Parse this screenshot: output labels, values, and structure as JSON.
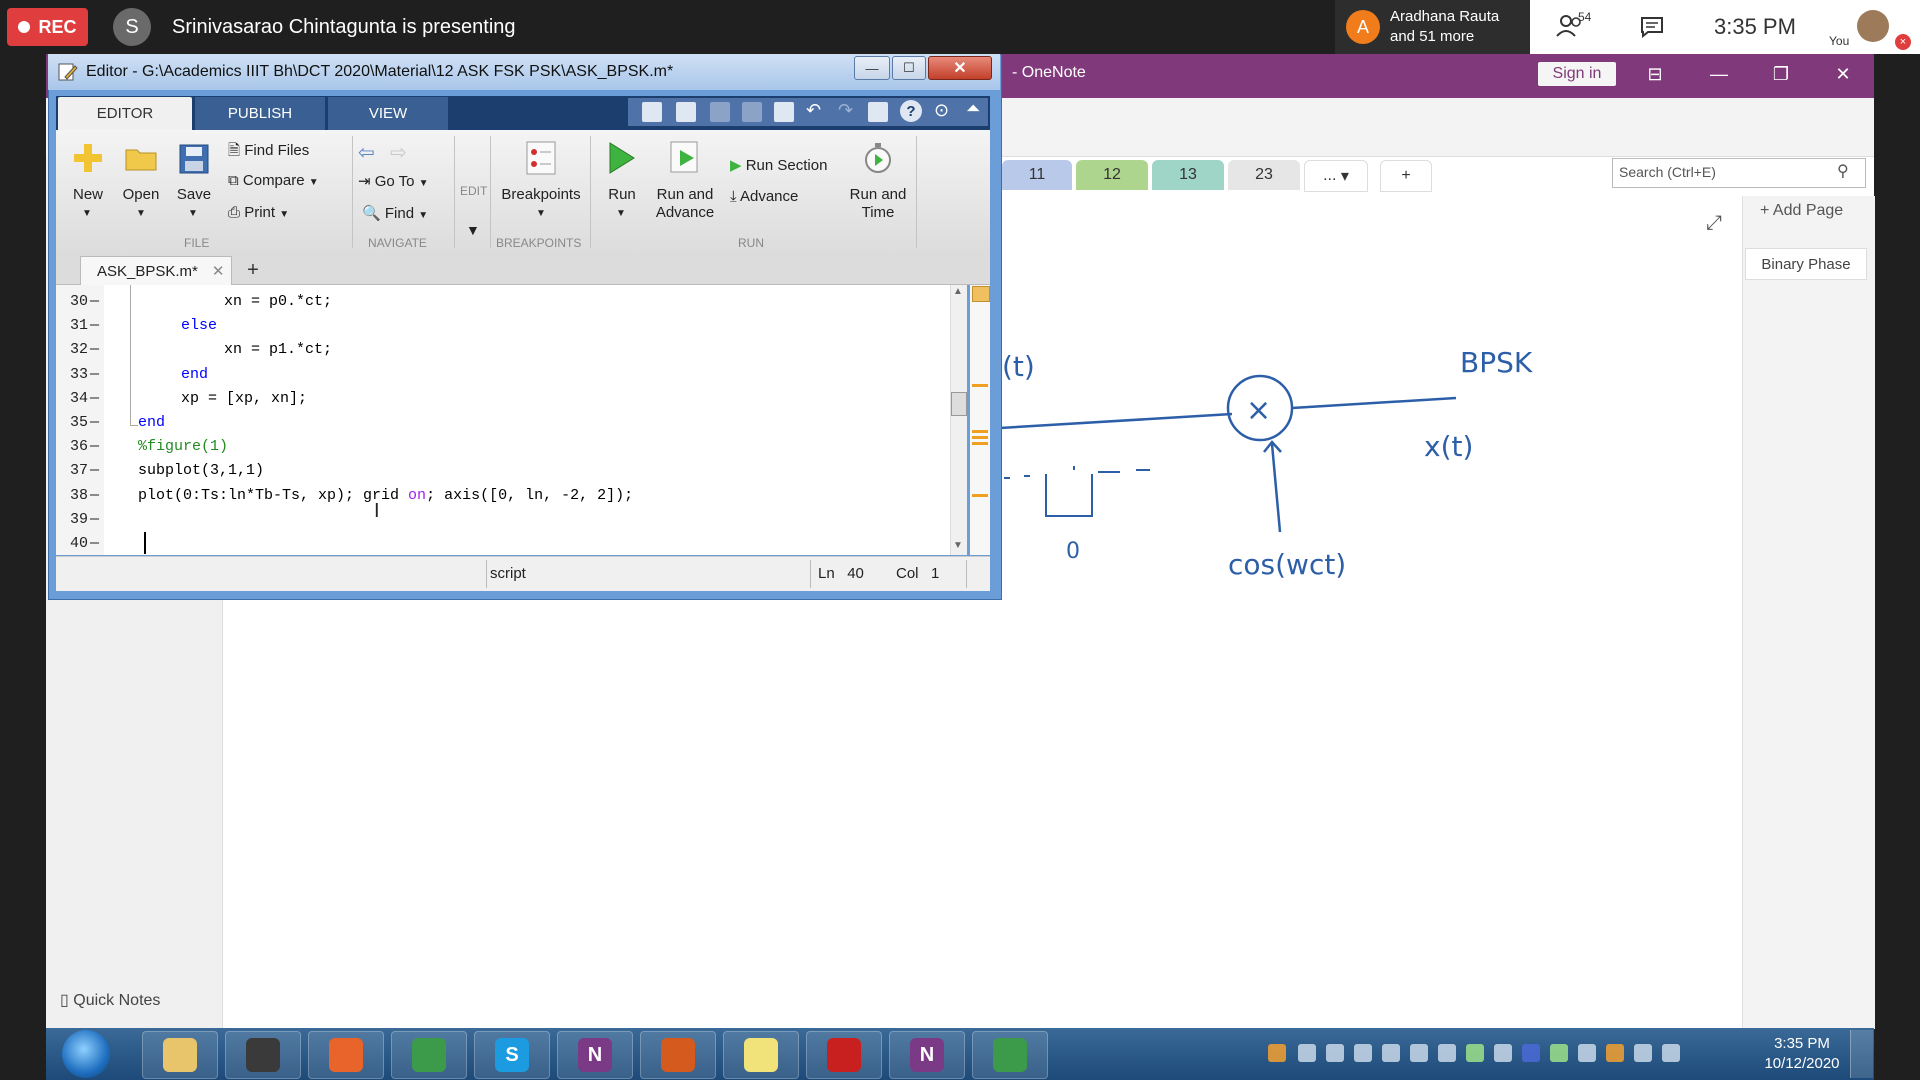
{
  "meeting": {
    "rec_label": "REC",
    "presenter_initial": "S",
    "presenting_text": "Srinivasarao Chintagunta is presenting",
    "viewer_initial": "A",
    "viewer_line1": "Aradhana Rauta",
    "viewer_line2": "and 51 more",
    "participant_count": "54",
    "time": "3:35 PM",
    "you_label": "You"
  },
  "onenote": {
    "title": "- OneNote",
    "sign_in": "Sign in",
    "section_tabs": [
      {
        "label": "11",
        "color": "#b9c9ea"
      },
      {
        "label": "12",
        "color": "#aed58e"
      },
      {
        "label": "13",
        "color": "#9fd5c6"
      },
      {
        "label": "23",
        "color": "#e6e6e6"
      },
      {
        "label": "...",
        "color": "#ffffff"
      },
      {
        "label": "+",
        "color": "#ffffff"
      }
    ],
    "search_placeholder": "Search (Ctrl+E)",
    "add_page": "+ Add Page",
    "page_title": "Binary Phase",
    "quick_notes": "Quick Notes",
    "ink": {
      "t_label": "(t)",
      "bpsk_label": "BPSK",
      "xt_label": "x(t)",
      "cos_label": "cos(wct)",
      "zero_label": "0",
      "multiply": "×"
    }
  },
  "editor": {
    "title": "Editor - G:\\Academics IIIT Bh\\DCT 2020\\Material\\12 ASK FSK PSK\\ASK_BPSK.m*",
    "tabs": [
      "EDITOR",
      "PUBLISH",
      "VIEW"
    ],
    "ribbon": {
      "new": "New",
      "open": "Open",
      "save": "Save",
      "find_files": "Find Files",
      "compare": "Compare",
      "print": "Print",
      "go_to": "Go To",
      "find": "Find",
      "edit": "EDIT",
      "breakpoints": "Breakpoints",
      "run": "Run",
      "run_and_advance_1": "Run and",
      "run_and_advance_2": "Advance",
      "run_section": "Run Section",
      "advance": "Advance",
      "run_and_time_1": "Run and",
      "run_and_time_2": "Time",
      "groups": {
        "file": "FILE",
        "navigate": "NAVIGATE",
        "breakpoints": "BREAKPOINTS",
        "run": "RUN"
      }
    },
    "doc_tab": "ASK_BPSK.m*",
    "lines": [
      {
        "n": "30",
        "indent": 2,
        "code": "xn = p0.*ct;",
        "type": "plain"
      },
      {
        "n": "31",
        "indent": 1,
        "code": "else",
        "type": "kw"
      },
      {
        "n": "32",
        "indent": 2,
        "code": "xn = p1.*ct;",
        "type": "plain"
      },
      {
        "n": "33",
        "indent": 1,
        "code": "end",
        "type": "kw"
      },
      {
        "n": "34",
        "indent": 1,
        "code": "xp = [xp, xn];",
        "type": "plain"
      },
      {
        "n": "35",
        "indent": 0,
        "code": "end",
        "type": "kw"
      },
      {
        "n": "36",
        "indent": 0,
        "code": "%figure(1)",
        "type": "comment"
      },
      {
        "n": "37",
        "indent": 0,
        "code": "subplot(3,1,1)",
        "type": "plain"
      },
      {
        "n": "38",
        "indent": 0,
        "code": "plot(0:Ts:ln*Tb-Ts, xp); grid on; axis([0, ln, -2, 2]);",
        "type": "plot"
      },
      {
        "n": "39",
        "indent": 0,
        "code": "",
        "type": "plain"
      },
      {
        "n": "40",
        "indent": 0,
        "code": "",
        "type": "plain"
      }
    ],
    "status": {
      "type": "script",
      "ln_label": "Ln",
      "ln": "40",
      "col_label": "Col",
      "col": "1"
    }
  },
  "taskbar": {
    "apps": [
      {
        "name": "explorer",
        "label": "",
        "color": "#e8c46a"
      },
      {
        "name": "media",
        "label": "",
        "color": "#3a3a3a"
      },
      {
        "name": "firefox",
        "label": "",
        "color": "#e8642a"
      },
      {
        "name": "chrome",
        "label": "",
        "color": "#3c9b4a"
      },
      {
        "name": "skype",
        "label": "S",
        "color": "#1d9be0"
      },
      {
        "name": "onenote",
        "label": "N",
        "color": "#7b3a86"
      },
      {
        "name": "matlab",
        "label": "",
        "color": "#d45a1e"
      },
      {
        "name": "sticky-notes",
        "label": "",
        "color": "#f2e27a"
      },
      {
        "name": "acrobat",
        "label": "",
        "color": "#c8201e"
      },
      {
        "name": "onenote-2",
        "label": "N",
        "color": "#7b3a86"
      },
      {
        "name": "chrome-2",
        "label": "",
        "color": "#3c9b4a"
      }
    ],
    "clock_time": "3:35 PM",
    "clock_date": "10/12/2020"
  }
}
